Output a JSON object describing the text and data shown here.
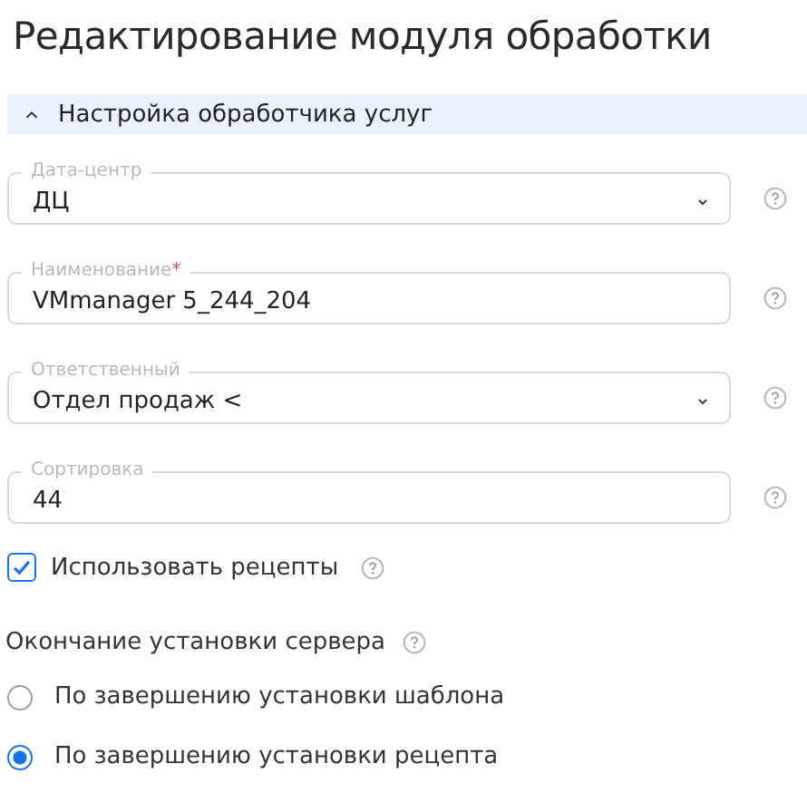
{
  "title": "Редактирование модуля обработки",
  "section": {
    "title": "Настройка обработчика услуг",
    "expanded": true
  },
  "fields": [
    {
      "kind": "select",
      "label": "Дата-центр",
      "value": "ДЦ"
    },
    {
      "kind": "input",
      "label": "Наименование",
      "required_mark": "*",
      "value": "VMmanager 5_244_204"
    },
    {
      "kind": "select",
      "label": "Ответственный",
      "value": "Отдел продаж <"
    },
    {
      "kind": "input",
      "label": "Сортировка",
      "value": "44"
    }
  ],
  "checkbox": {
    "label": "Использовать рецепты",
    "checked": true
  },
  "radio_group": {
    "label": "Окончание установки сервера",
    "options": [
      {
        "label": "По завершению установки шаблона",
        "selected": false
      },
      {
        "label": "По завершению установки рецепта",
        "selected": true
      }
    ]
  }
}
